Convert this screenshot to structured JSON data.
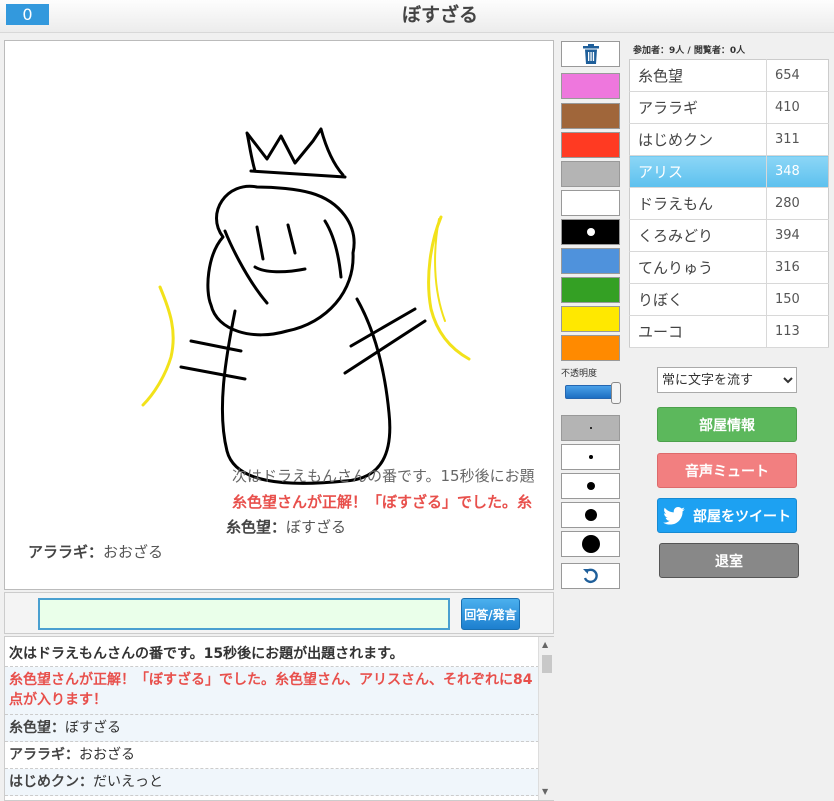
{
  "header": {
    "timer": "0",
    "title": "ぼすざる"
  },
  "canvas_messages": {
    "system": "次はドラえもんさんの番です。15秒後にお題",
    "correct": "糸色望さんが正解！「ぼすざる」でした。糸",
    "msg1_user": "糸色望：",
    "msg1_text": "ぼすざる",
    "msg2_user": "アララギ：",
    "msg2_text": "おおざる"
  },
  "palette": [
    "#ee77dd",
    "#a0663a",
    "#ff3a22",
    "#b4b4b4",
    "#ffffff",
    "#000000",
    "#4f92dc",
    "#34a024",
    "#ffe800",
    "#ff8a00"
  ],
  "selected_color_index": 5,
  "opacity": {
    "label": "不透明度",
    "value": 0.9
  },
  "room": {
    "counts": "参加者：9人 / 閲覧者：0人"
  },
  "players": [
    {
      "name": "糸色望",
      "score": "654"
    },
    {
      "name": "アララギ",
      "score": "410"
    },
    {
      "name": "はじめクン",
      "score": "311"
    },
    {
      "name": "アリス",
      "score": "348"
    },
    {
      "name": "ドラえもん",
      "score": "280"
    },
    {
      "name": "くろみどり",
      "score": "394"
    },
    {
      "name": "てんりゅう",
      "score": "316"
    },
    {
      "name": "りぼく",
      "score": "150"
    },
    {
      "name": "ユーコ",
      "score": "113"
    }
  ],
  "active_player_index": 3,
  "controls": {
    "scroll_mode": "常に文字を流す",
    "room_info": "部屋情報",
    "mute": "音声ミュート",
    "tweet": "部屋をツイート",
    "leave": "退室"
  },
  "input": {
    "value": "",
    "submit": "回答/発言"
  },
  "log": [
    {
      "type": "bold",
      "text": "次はドラえもんさんの番です。15秒後にお題が出題されます。"
    },
    {
      "type": "correct",
      "text": "糸色望さんが正解！「ぼすざる」でした。糸色望さん、アリスさん、それぞれに84点が入ります！"
    },
    {
      "type": "chat",
      "user": "糸色望：",
      "text": "ぼすざる"
    },
    {
      "type": "chat",
      "user": "アララギ：",
      "text": "おおざる"
    },
    {
      "type": "chat",
      "user": "はじめクン：",
      "text": "だいえっと"
    }
  ]
}
